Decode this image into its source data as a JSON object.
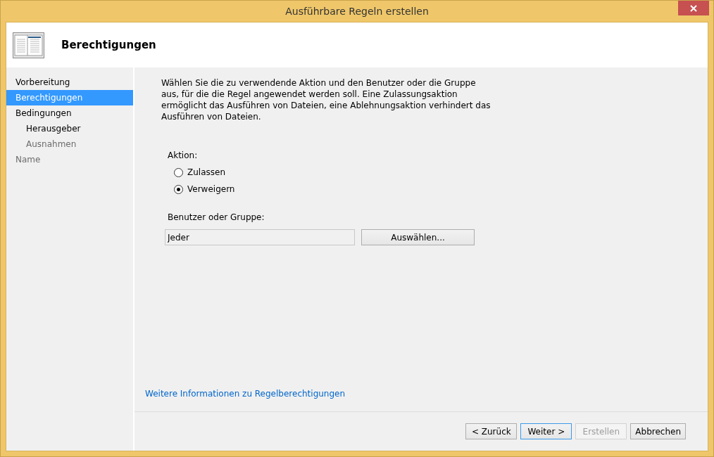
{
  "window": {
    "title": "Ausführbare Regeln erstellen"
  },
  "header": {
    "title": "Berechtigungen"
  },
  "steps": [
    {
      "label": "Vorbereitung",
      "selected": false,
      "disabled": false
    },
    {
      "label": "Berechtigungen",
      "selected": true,
      "disabled": false
    },
    {
      "label": "Bedingungen",
      "selected": false,
      "disabled": false,
      "children": [
        {
          "label": "Herausgeber",
          "selected": false,
          "disabled": false
        },
        {
          "label": "Ausnahmen",
          "selected": false,
          "disabled": true
        }
      ]
    },
    {
      "label": "Name",
      "selected": false,
      "disabled": true
    }
  ],
  "description": "Wählen Sie die zu verwendende Aktion und den Benutzer oder die Gruppe aus, für die die Regel angewendet werden soll. Eine Zulassungsaktion ermöglicht das Ausführen von Dateien, eine Ablehnungsaktion verhindert das Ausführen von Dateien.",
  "action": {
    "label": "Aktion:",
    "options": [
      {
        "label": "Zulassen",
        "selected": false
      },
      {
        "label": "Verweigern",
        "selected": true
      }
    ]
  },
  "user": {
    "label": "Benutzer oder Gruppe:",
    "value": "Jeder",
    "button": "Auswählen..."
  },
  "link": "Weitere Informationen zu Regelberechtigungen",
  "buttons": [
    {
      "label": "< Zurück",
      "default": false,
      "disabled": false
    },
    {
      "label": "Weiter >",
      "default": true,
      "disabled": false
    },
    {
      "label": "Erstellen",
      "default": false,
      "disabled": true
    },
    {
      "label": "Abbrechen",
      "default": false,
      "disabled": false
    }
  ]
}
